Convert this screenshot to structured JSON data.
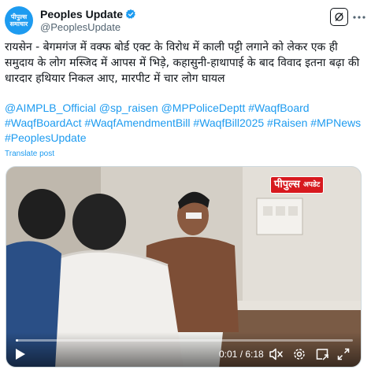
{
  "account": {
    "display_name": "Peoples Update",
    "handle": "@PeoplesUpdate",
    "avatar_text": "पीपुल्स समाचार",
    "verified": true
  },
  "tweet": {
    "text": "रायसेन - बेगमगंज में वक्फ बोर्ड एक्ट के विरोध में काली पट्टी लगाने को लेकर एक ही समुदाय के लोग मस्जिद में आपस में भिड़े, कहासुनी-हाथापाई के बाद विवाद इतना बढ़ा की धारदार हथियार निकल आए, मारपीट में चार लोग घायल",
    "hashtags": "@AIMPLB_Official @sp_raisen @MPPoliceDeptt #WaqfBoard #WaqfBoardAct #WaqfAmendmentBill #WaqfBill2025 #Raisen #MPNews #PeoplesUpdate",
    "translate_label": "Translate post"
  },
  "video": {
    "logo_main": "पीपुल्स",
    "logo_sub": "अपडेट",
    "current_time": "0:01 / 6:18",
    "progress": 0.003
  },
  "colors": {
    "accent": "#1d9bf0",
    "text": "#0f1419",
    "muted": "#536471",
    "logo_red": "#d7191f"
  },
  "icons": [
    "grok-icon",
    "more-icon",
    "verified-badge-icon",
    "play-icon",
    "closed-captions-icon",
    "volume-icon",
    "settings-icon",
    "picture-in-picture-icon",
    "fullscreen-icon"
  ]
}
